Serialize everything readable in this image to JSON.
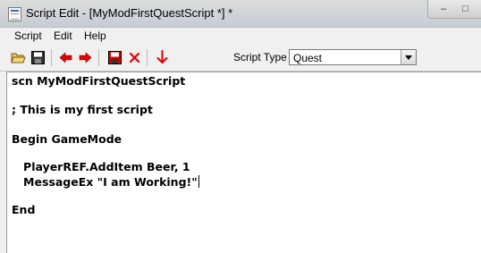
{
  "window": {
    "title": "Script Edit - [MyModFirstQuestScript *] *",
    "controls": {
      "minimize": "–",
      "maximize": "□"
    }
  },
  "menu": {
    "items": [
      {
        "label": "Script"
      },
      {
        "label": "Edit"
      },
      {
        "label": "Help"
      }
    ]
  },
  "toolbar": {
    "buttons": [
      {
        "icon": "open-folder-icon"
      },
      {
        "icon": "save-icon"
      },
      {
        "icon": "previous-arrow-icon"
      },
      {
        "icon": "next-arrow-icon"
      },
      {
        "icon": "save-red-icon"
      },
      {
        "icon": "delete-x-icon"
      },
      {
        "icon": "down-arrow-icon"
      }
    ],
    "script_type_label": "Script Type",
    "script_type_value": "Quest"
  },
  "colors": {
    "accent_red": "#e00000",
    "title_bar": "#c7ccd3",
    "editor_bg": "#ffffff"
  },
  "editor": {
    "lines": [
      "scn MyModFirstQuestScript",
      "; This is my first script",
      "Begin GameMode",
      "   PlayerREF.AddItem Beer, 1",
      "   MessageEx \"I am Working!\"",
      "End"
    ]
  }
}
